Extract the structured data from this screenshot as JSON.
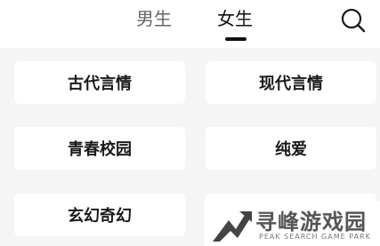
{
  "tabs": {
    "male_label": "男生",
    "female_label": "女生",
    "active": "女生"
  },
  "categories": [
    {
      "label": "古代言情"
    },
    {
      "label": "现代言情"
    },
    {
      "label": "青春校园"
    },
    {
      "label": "纯爱"
    },
    {
      "label": "玄幻奇幻"
    },
    {
      "label": ""
    }
  ],
  "watermark": {
    "main": "寻峰游戏园",
    "sub": "PEAK SEARCH GAME PARK"
  },
  "colors": {
    "background": "#f5f5f5",
    "card": "#ffffff",
    "active_tab": "#111111",
    "inactive_tab": "#666666"
  }
}
